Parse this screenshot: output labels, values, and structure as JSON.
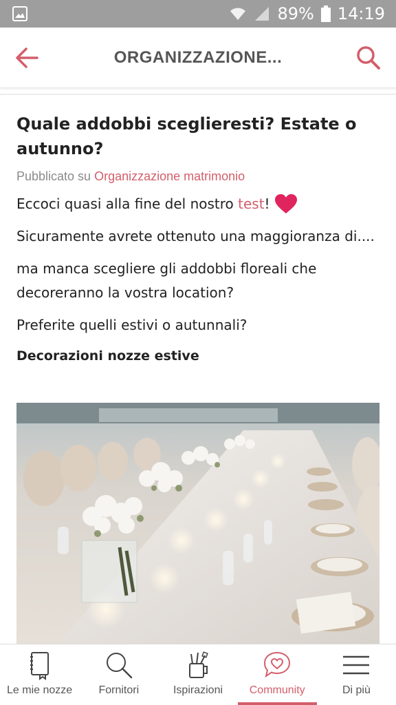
{
  "status_bar": {
    "battery": "89%",
    "time": "14:19",
    "icons": [
      "image-icon",
      "wifi-icon",
      "signal-icon",
      "battery-icon"
    ]
  },
  "app_bar": {
    "title": "ORGANIZZAZIONE...",
    "back_icon": "back-arrow-icon",
    "search_icon": "search-icon"
  },
  "post": {
    "title": "Quale addobbi sceglieresti? Estate o autunno?",
    "meta_prefix": "Pubblicato su ",
    "meta_category": "Organizzazione matrimonio",
    "paragraphs": {
      "p1_before": "Eccoci quasi alla fine del nostro ",
      "p1_link": "test",
      "p1_after": "!",
      "p2": "Sicuramente avrete ottenuto una maggioranza di....",
      "p3": "ma manca scegliere gli addobbi floreali che decoreranno la vostra location?",
      "p4": "Preferite quelli estivi o autunnali?"
    },
    "section_heading": "Decorazioni nozze estive"
  },
  "bottom_nav": {
    "items": [
      {
        "label": "Le mie nozze",
        "icon": "notebook-icon"
      },
      {
        "label": "Fornitori",
        "icon": "search-icon"
      },
      {
        "label": "Ispirazioni",
        "icon": "brush-cup-icon"
      },
      {
        "label": "Community",
        "icon": "heart-bubble-icon"
      },
      {
        "label": "Di più",
        "icon": "menu-icon"
      }
    ],
    "active_index": 3
  },
  "colors": {
    "accent": "#d35e6a",
    "heart": "#e0245e",
    "status_bar": "#9e9e9e"
  }
}
